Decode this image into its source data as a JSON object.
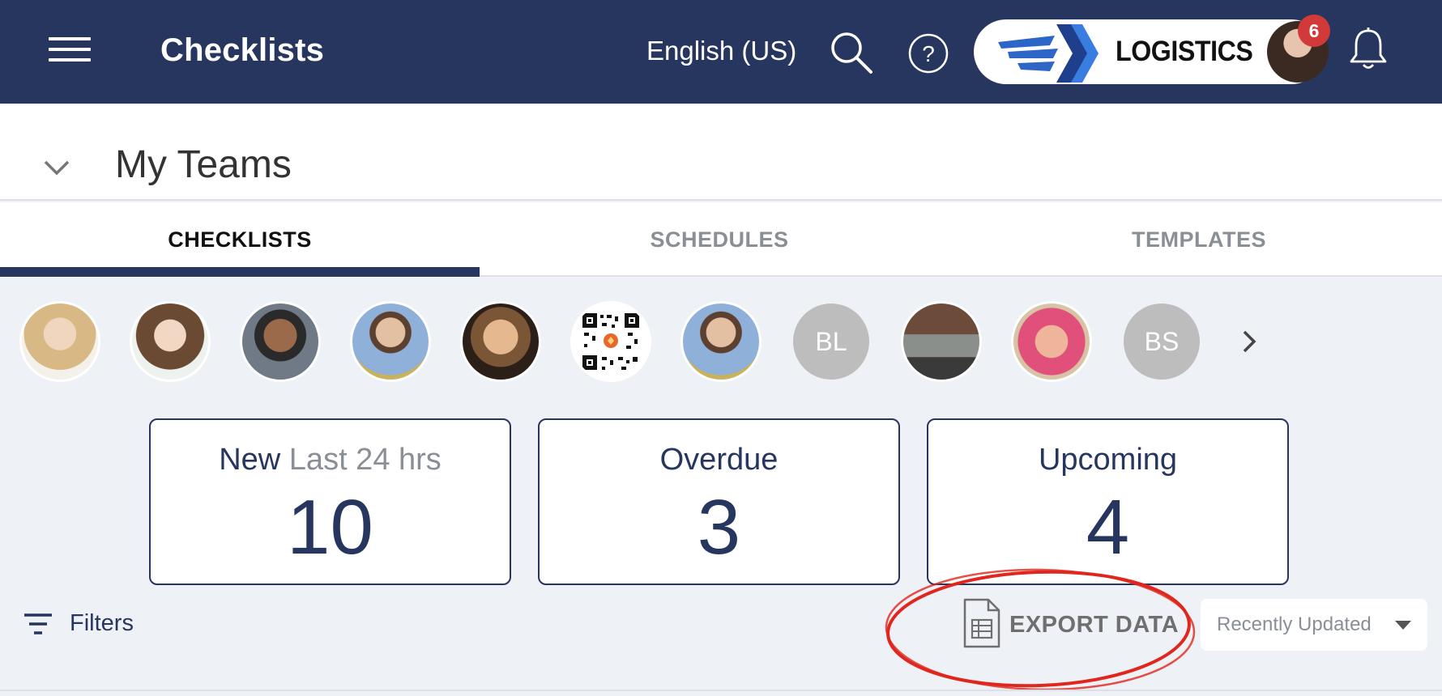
{
  "colors": {
    "navy": "#27365e",
    "badge_red": "#d23a3a",
    "muted_gray": "#8a8f96",
    "annotation_red": "#e0261d"
  },
  "header": {
    "title": "Checklists",
    "language": "English (US)",
    "brand_name": "LOGISTICS",
    "notification_count": "6",
    "icons": [
      "menu-icon",
      "search-icon",
      "help-icon",
      "bell-icon"
    ]
  },
  "section": {
    "title": "My Teams"
  },
  "tabs": [
    {
      "label": "CHECKLISTS",
      "active": true
    },
    {
      "label": "SCHEDULES",
      "active": false
    },
    {
      "label": "TEMPLATES",
      "active": false
    }
  ],
  "team_members": [
    {
      "type": "photo"
    },
    {
      "type": "photo"
    },
    {
      "type": "photo"
    },
    {
      "type": "photo"
    },
    {
      "type": "photo"
    },
    {
      "type": "qr-code"
    },
    {
      "type": "photo"
    },
    {
      "type": "initials",
      "initials": "BL"
    },
    {
      "type": "photo"
    },
    {
      "type": "photo"
    },
    {
      "type": "initials",
      "initials": "BS"
    }
  ],
  "stats": [
    {
      "label": "New",
      "sublabel": "Last 24 hrs",
      "value": "10"
    },
    {
      "label": "Overdue",
      "sublabel": "",
      "value": "3"
    },
    {
      "label": "Upcoming",
      "sublabel": "",
      "value": "4"
    }
  ],
  "toolbar": {
    "filters_label": "Filters",
    "export_label": "EXPORT DATA",
    "sort_selected": "Recently Updated"
  }
}
